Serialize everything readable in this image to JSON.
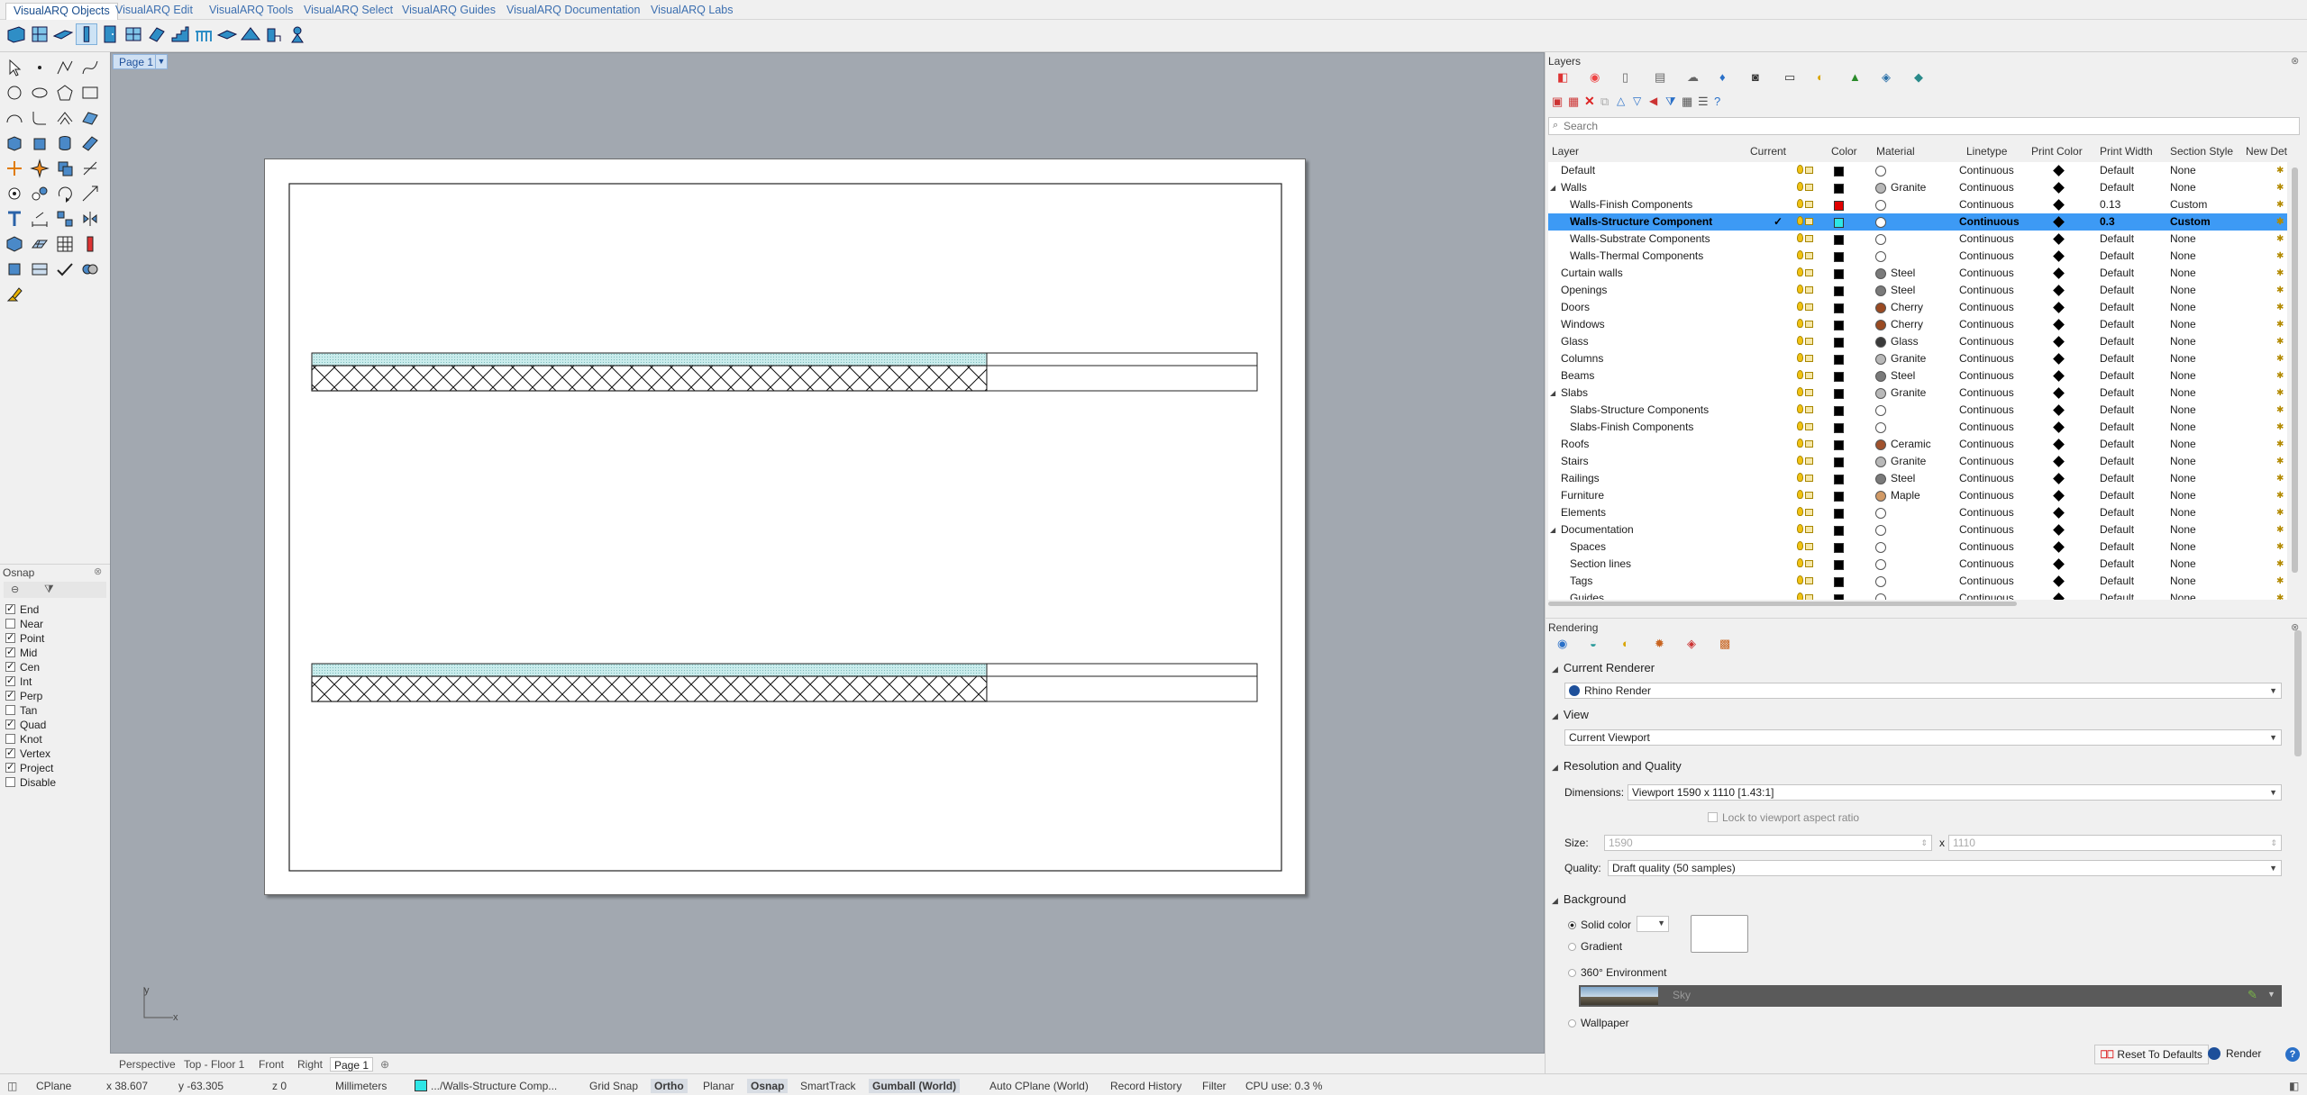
{
  "ribbon": {
    "tabs": [
      "VisualARQ Objects",
      "VisualARQ Edit",
      "VisualARQ Tools",
      "VisualARQ Select",
      "VisualARQ Guides",
      "VisualARQ Documentation",
      "VisualARQ Labs"
    ],
    "active_tab": "VisualARQ Objects"
  },
  "viewport": {
    "page_tab": "Page 1",
    "bottom_tabs": [
      "Perspective",
      "Top - Floor 1",
      "Front",
      "Right",
      "Page 1"
    ],
    "axis_x": "x",
    "axis_y": "y"
  },
  "osnap": {
    "title": "Osnap",
    "items": [
      {
        "label": "End",
        "checked": true
      },
      {
        "label": "Near",
        "checked": false
      },
      {
        "label": "Point",
        "checked": true
      },
      {
        "label": "Mid",
        "checked": true
      },
      {
        "label": "Cen",
        "checked": true
      },
      {
        "label": "Int",
        "checked": true
      },
      {
        "label": "Perp",
        "checked": true
      },
      {
        "label": "Tan",
        "checked": false
      },
      {
        "label": "Quad",
        "checked": true
      },
      {
        "label": "Knot",
        "checked": false
      },
      {
        "label": "Vertex",
        "checked": true
      },
      {
        "label": "Project",
        "checked": true
      },
      {
        "label": "Disable",
        "checked": false
      }
    ]
  },
  "layers": {
    "title": "Layers",
    "search_placeholder": "Search",
    "columns": [
      "Layer",
      "Current",
      "Color",
      "Material",
      "Linetype",
      "Print Color",
      "Print Width",
      "Section Style",
      "New Det"
    ],
    "rows": [
      {
        "name": "Default",
        "indent": 0,
        "current": false,
        "color": "#000000",
        "material": "",
        "linetype": "Continuous",
        "print_width": "Default",
        "section_style": "None",
        "expander": ""
      },
      {
        "name": "Walls",
        "indent": 0,
        "current": false,
        "color": "#000000",
        "material": "Granite",
        "material_color": "#b8b8b8",
        "linetype": "Continuous",
        "print_width": "Default",
        "section_style": "None",
        "expander": "◢"
      },
      {
        "name": "Walls-Finish Components",
        "indent": 1,
        "current": false,
        "color": "#e00000",
        "material": "",
        "linetype": "Continuous",
        "print_width": "0.13",
        "section_style": "Custom",
        "expander": ""
      },
      {
        "name": "Walls-Structure Component",
        "indent": 1,
        "current": true,
        "selected": true,
        "color": "#2ee6e6",
        "material": "",
        "linetype": "Continuous",
        "print_width": "0.3",
        "section_style": "Custom",
        "expander": ""
      },
      {
        "name": "Walls-Substrate Components",
        "indent": 1,
        "current": false,
        "color": "#000000",
        "material": "",
        "linetype": "Continuous",
        "print_width": "Default",
        "section_style": "None",
        "expander": ""
      },
      {
        "name": "Walls-Thermal Components",
        "indent": 1,
        "current": false,
        "color": "#000000",
        "material": "",
        "linetype": "Continuous",
        "print_width": "Default",
        "section_style": "None",
        "expander": ""
      },
      {
        "name": "Curtain walls",
        "indent": 0,
        "current": false,
        "color": "#000000",
        "material": "Steel",
        "material_color": "#7a7a7a",
        "linetype": "Continuous",
        "print_width": "Default",
        "section_style": "None",
        "expander": ""
      },
      {
        "name": "Openings",
        "indent": 0,
        "current": false,
        "color": "#000000",
        "material": "Steel",
        "material_color": "#7a7a7a",
        "linetype": "Continuous",
        "print_width": "Default",
        "section_style": "None",
        "expander": ""
      },
      {
        "name": "Doors",
        "indent": 0,
        "current": false,
        "color": "#000000",
        "material": "Cherry",
        "material_color": "#9a4a22",
        "linetype": "Continuous",
        "print_width": "Default",
        "section_style": "None",
        "expander": ""
      },
      {
        "name": "Windows",
        "indent": 0,
        "current": false,
        "color": "#000000",
        "material": "Cherry",
        "material_color": "#9a4a22",
        "linetype": "Continuous",
        "print_width": "Default",
        "section_style": "None",
        "expander": ""
      },
      {
        "name": "Glass",
        "indent": 0,
        "current": false,
        "color": "#000000",
        "material": "Glass",
        "material_color": "#3a3a3a",
        "linetype": "Continuous",
        "print_width": "Default",
        "section_style": "None",
        "expander": ""
      },
      {
        "name": "Columns",
        "indent": 0,
        "current": false,
        "color": "#000000",
        "material": "Granite",
        "material_color": "#b8b8b8",
        "linetype": "Continuous",
        "print_width": "Default",
        "section_style": "None",
        "expander": ""
      },
      {
        "name": "Beams",
        "indent": 0,
        "current": false,
        "color": "#000000",
        "material": "Steel",
        "material_color": "#7a7a7a",
        "linetype": "Continuous",
        "print_width": "Default",
        "section_style": "None",
        "expander": ""
      },
      {
        "name": "Slabs",
        "indent": 0,
        "current": false,
        "color": "#000000",
        "material": "Granite",
        "material_color": "#b8b8b8",
        "linetype": "Continuous",
        "print_width": "Default",
        "section_style": "None",
        "expander": "◢"
      },
      {
        "name": "Slabs-Structure Components",
        "indent": 1,
        "current": false,
        "color": "#000000",
        "material": "",
        "linetype": "Continuous",
        "print_width": "Default",
        "section_style": "None",
        "expander": ""
      },
      {
        "name": "Slabs-Finish Components",
        "indent": 1,
        "current": false,
        "color": "#000000",
        "material": "",
        "linetype": "Continuous",
        "print_width": "Default",
        "section_style": "None",
        "expander": ""
      },
      {
        "name": "Roofs",
        "indent": 0,
        "current": false,
        "color": "#000000",
        "material": "Ceramic",
        "material_color": "#a0522d",
        "linetype": "Continuous",
        "print_width": "Default",
        "section_style": "None",
        "expander": ""
      },
      {
        "name": "Stairs",
        "indent": 0,
        "current": false,
        "color": "#000000",
        "material": "Granite",
        "material_color": "#b8b8b8",
        "linetype": "Continuous",
        "print_width": "Default",
        "section_style": "None",
        "expander": ""
      },
      {
        "name": "Railings",
        "indent": 0,
        "current": false,
        "color": "#000000",
        "material": "Steel",
        "material_color": "#7a7a7a",
        "linetype": "Continuous",
        "print_width": "Default",
        "section_style": "None",
        "expander": ""
      },
      {
        "name": "Furniture",
        "indent": 0,
        "current": false,
        "color": "#000000",
        "material": "Maple",
        "material_color": "#d19a66",
        "linetype": "Continuous",
        "print_width": "Default",
        "section_style": "None",
        "expander": ""
      },
      {
        "name": "Elements",
        "indent": 0,
        "current": false,
        "color": "#000000",
        "material": "",
        "linetype": "Continuous",
        "print_width": "Default",
        "section_style": "None",
        "expander": ""
      },
      {
        "name": "Documentation",
        "indent": 0,
        "current": false,
        "color": "#000000",
        "material": "",
        "linetype": "Continuous",
        "print_width": "Default",
        "section_style": "None",
        "expander": "◢"
      },
      {
        "name": "Spaces",
        "indent": 1,
        "current": false,
        "color": "#000000",
        "material": "",
        "linetype": "Continuous",
        "print_width": "Default",
        "section_style": "None",
        "expander": ""
      },
      {
        "name": "Section lines",
        "indent": 1,
        "current": false,
        "color": "#000000",
        "material": "",
        "linetype": "Continuous",
        "print_width": "Default",
        "section_style": "None",
        "expander": ""
      },
      {
        "name": "Tags",
        "indent": 1,
        "current": false,
        "color": "#000000",
        "material": "",
        "linetype": "Continuous",
        "print_width": "Default",
        "section_style": "None",
        "expander": ""
      },
      {
        "name": "Guides",
        "indent": 1,
        "current": false,
        "color": "#000000",
        "material": "",
        "linetype": "Continuous",
        "print_width": "Default",
        "section_style": "None",
        "expander": ""
      }
    ]
  },
  "rendering": {
    "title": "Rendering",
    "current_renderer_heading": "Current Renderer",
    "renderer": "Rhino Render",
    "view_heading": "View",
    "view": "Current Viewport",
    "resolution_heading": "Resolution and Quality",
    "dimensions_label": "Dimensions:",
    "dimensions": "Viewport 1590 x 1110 [1.43:1]",
    "lock_label": "Lock to viewport aspect ratio",
    "size_label": "Size:",
    "size_w": "1590",
    "size_x": "x",
    "size_h": "1110",
    "quality_label": "Quality:",
    "quality": "Draft quality (50 samples)",
    "background_heading": "Background",
    "bg_solid": "Solid color",
    "bg_gradient": "Gradient",
    "bg_360": "360° Environment",
    "env_name": "Sky",
    "bg_wallpaper": "Wallpaper",
    "reset_button": "Reset To Defaults",
    "render_button": "Render"
  },
  "status": {
    "cplane": "CPlane",
    "x": "x 38.607",
    "y": "y -63.305",
    "z": "z 0",
    "units": "Millimeters",
    "layer": ".../Walls-Structure Comp...",
    "layer_color": "#2ee6e6",
    "grid_snap": "Grid Snap",
    "ortho": "Ortho",
    "planar": "Planar",
    "osnap": "Osnap",
    "smarttrack": "SmartTrack",
    "gumball": "Gumball (World)",
    "auto_cplane": "Auto CPlane (World)",
    "record_history": "Record History",
    "filter": "Filter",
    "cpu": "CPU use: 0.3 %"
  }
}
